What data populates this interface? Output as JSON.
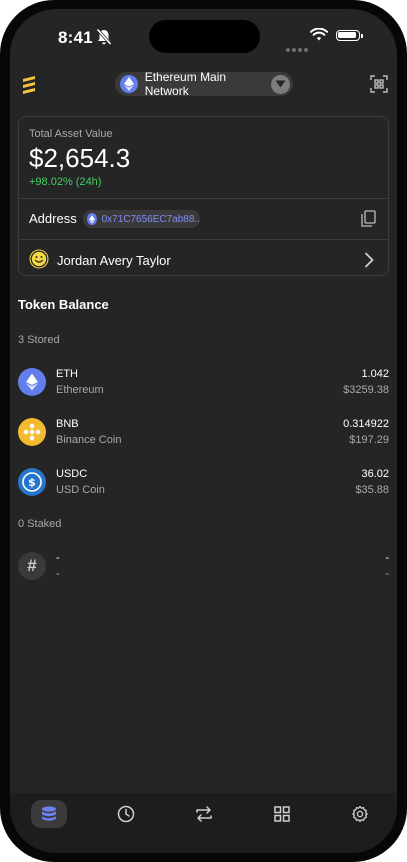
{
  "status_bar": {
    "time": "8:41"
  },
  "header": {
    "network": "Ethereum Main Network",
    "icons": [
      "app-logo-icon",
      "ethereum-icon",
      "chevron-down-icon",
      "qr-scan-icon"
    ]
  },
  "wallet_card": {
    "asset_label": "Total Asset Value",
    "asset_value": "$2,654.3",
    "asset_change": "+98.02% (24h)",
    "address_label": "Address",
    "address_value": "0x71C7656EC7ab88..",
    "user_name": "Jordan Avery Taylor",
    "colors": {
      "change_positive": "#3fd264",
      "address_text": "#7f8cf5"
    }
  },
  "token_balance": {
    "title": "Token Balance",
    "stored_label": "3 Stored",
    "tokens": [
      {
        "symbol": "ETH",
        "name": "Ethereum",
        "amount": "1.042",
        "usd": "$3259.38",
        "icon": "ethereum-icon",
        "color": "#627eea"
      },
      {
        "symbol": "BNB",
        "name": "Binance Coin",
        "amount": "0.314922",
        "usd": "$197.29",
        "icon": "binance-icon",
        "color": "#f3ba2f"
      },
      {
        "symbol": "USDC",
        "name": "USD Coin",
        "amount": "36.02",
        "usd": "$35.88",
        "icon": "usdc-icon",
        "color": "#2775ca"
      }
    ],
    "staked_label": "0 Staked",
    "staked": [
      {
        "symbol": "-",
        "name": "-",
        "amount": "-",
        "usd": "-",
        "icon": "hash-icon"
      }
    ]
  },
  "tab_bar": {
    "active": "assets",
    "tabs": [
      "assets-tab",
      "history-tab",
      "swap-tab",
      "apps-tab",
      "settings-tab"
    ]
  }
}
